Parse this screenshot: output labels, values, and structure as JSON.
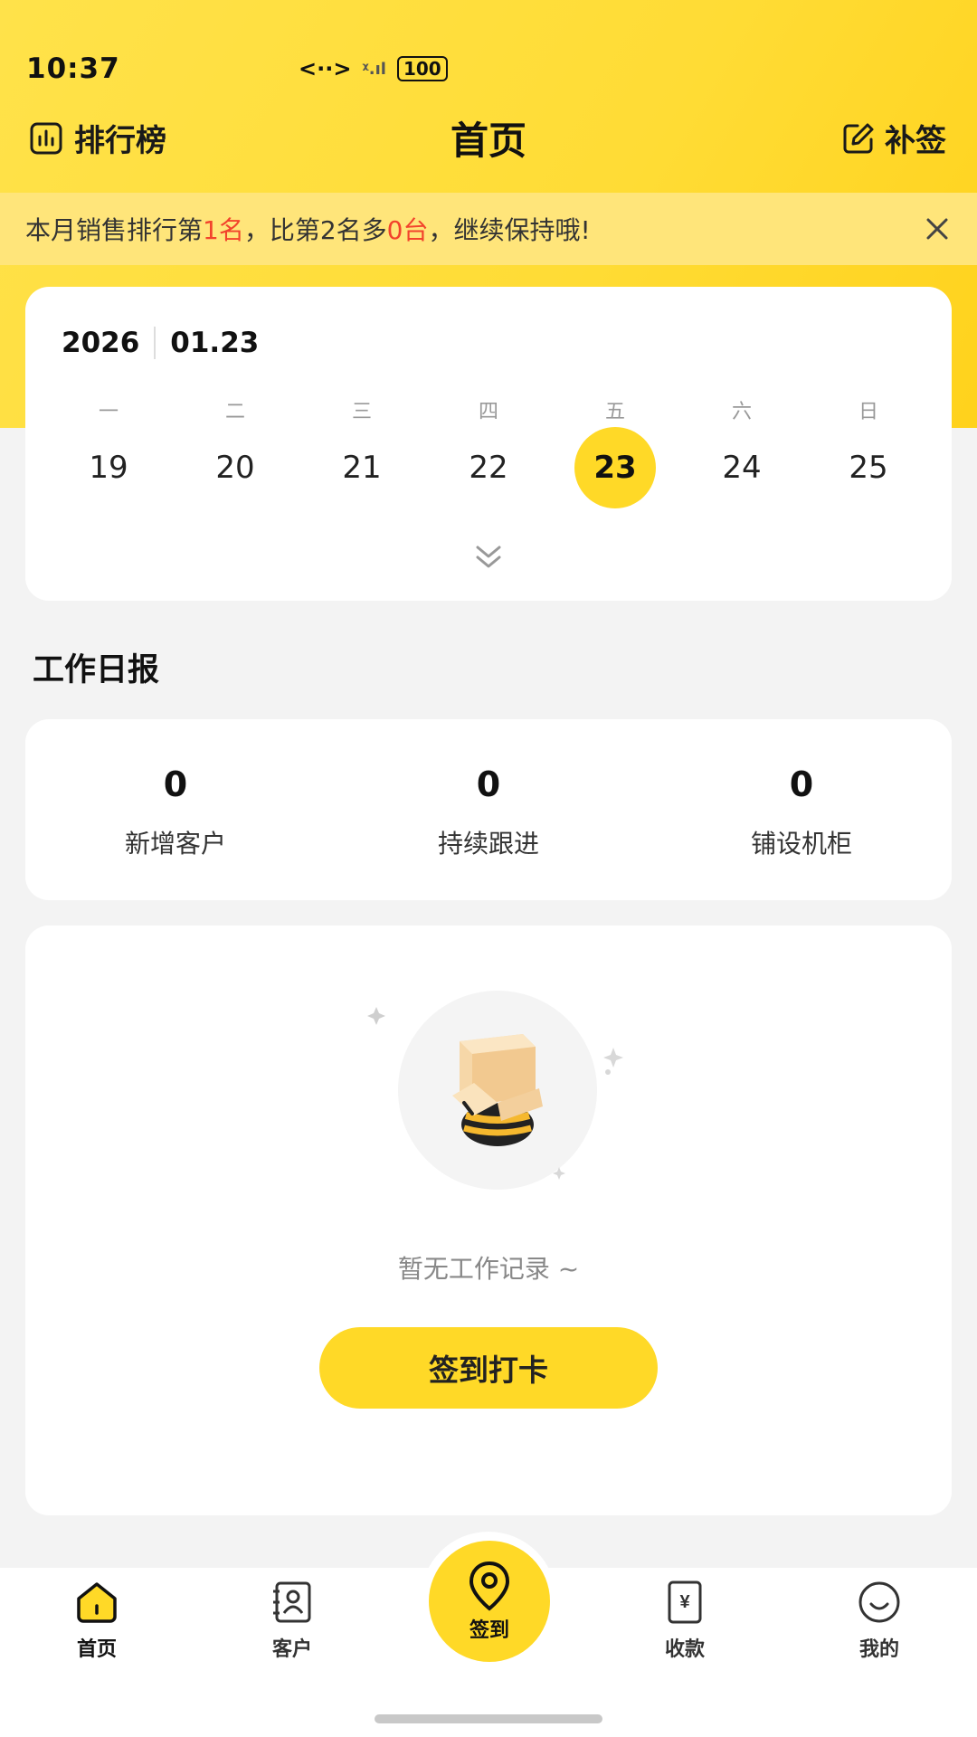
{
  "status_bar": {
    "time": "10:37",
    "network": "<··>",
    "signal": "ᵡ.ıl",
    "battery": "100"
  },
  "header": {
    "title": "首页",
    "left_label": "排行榜",
    "right_label": "补签"
  },
  "notice": {
    "prefix": "本月销售排行第",
    "rank": "1名",
    "middle": "，比第2名多",
    "diff": "0台",
    "suffix": "，继续保持哦!",
    "accent_color": "#f2432c"
  },
  "calendar": {
    "year": "2026",
    "date": "01.23",
    "weekdays": [
      "一",
      "二",
      "三",
      "四",
      "五",
      "六",
      "日"
    ],
    "days": [
      "19",
      "20",
      "21",
      "22",
      "23",
      "24",
      "25"
    ],
    "selected": "23"
  },
  "daily_report": {
    "title": "工作日报",
    "stats": [
      {
        "value": "0",
        "label": "新增客户"
      },
      {
        "value": "0",
        "label": "持续跟进"
      },
      {
        "value": "0",
        "label": "铺设机柜"
      }
    ]
  },
  "empty_state": {
    "text": "暂无工作记录 ~",
    "button": "签到打卡"
  },
  "tabbar": {
    "items": [
      {
        "label": "首页",
        "icon": "home-icon"
      },
      {
        "label": "客户",
        "icon": "contacts-icon"
      },
      {
        "label": "签到",
        "icon": "location-pin-icon"
      },
      {
        "label": "收款",
        "icon": "yuan-receipt-icon"
      },
      {
        "label": "我的",
        "icon": "smile-icon"
      }
    ]
  },
  "colors": {
    "brand_yellow": "#ffd927",
    "notice_bg": "#ffe57a",
    "page_bg": "#f3f3f3"
  }
}
